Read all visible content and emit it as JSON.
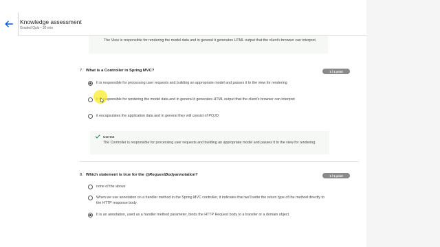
{
  "header": {
    "title": "Knowledge assessment",
    "subtitle": "Graded Quiz • 30 min"
  },
  "previous_feedback": "The View is responsible for rendering the model data and in general it generates HTML output that the client's browser can interpret.",
  "q7": {
    "number": "7.",
    "question": "What is a Controller in Spring MVC?",
    "points": "1 / 1 point",
    "options": [
      {
        "text": "It is responsible for processing user requests and building an appropriate model and passes it to the view for rendering",
        "checked": true
      },
      {
        "text": "It is responsible for rendering the model data and in general it generates HTML output that the client's browser can interpret",
        "checked": false
      },
      {
        "text": "it encapsulates the application data and in general they will consist of POJO",
        "checked": false
      }
    ],
    "feedback": {
      "label": "Correct",
      "text": "The Controller is responsible for processing user requests and building an appropriate model and passes it to the view for rendering."
    }
  },
  "q8": {
    "number": "8.",
    "question_prefix": "Which statement is true for the ",
    "question_italic": "@RequestBodyannotation",
    "question_suffix": "?",
    "points": "1 / 1 point",
    "options": [
      {
        "text": "none of the above",
        "checked": false
      },
      {
        "text": "When we use annotation on a handler method in the Spring MVC controller, it indicates that we'll write the return type of the method directly to the HTTP response body.",
        "checked": false
      },
      {
        "text": "It is an annotation, used as a handler method parameter, binds the HTTP Request body to a transfer or a domain object.",
        "checked": true
      }
    ]
  },
  "colors": {
    "accent": "#0056d2",
    "badge": "#8a8a8a",
    "feedback_bg": "#f5f8f4",
    "correct_icon": "#1f8354"
  },
  "icons": {
    "back": "arrow-left-icon",
    "correct": "checkmark-icon",
    "cursor": "mouse-pointer-icon"
  }
}
